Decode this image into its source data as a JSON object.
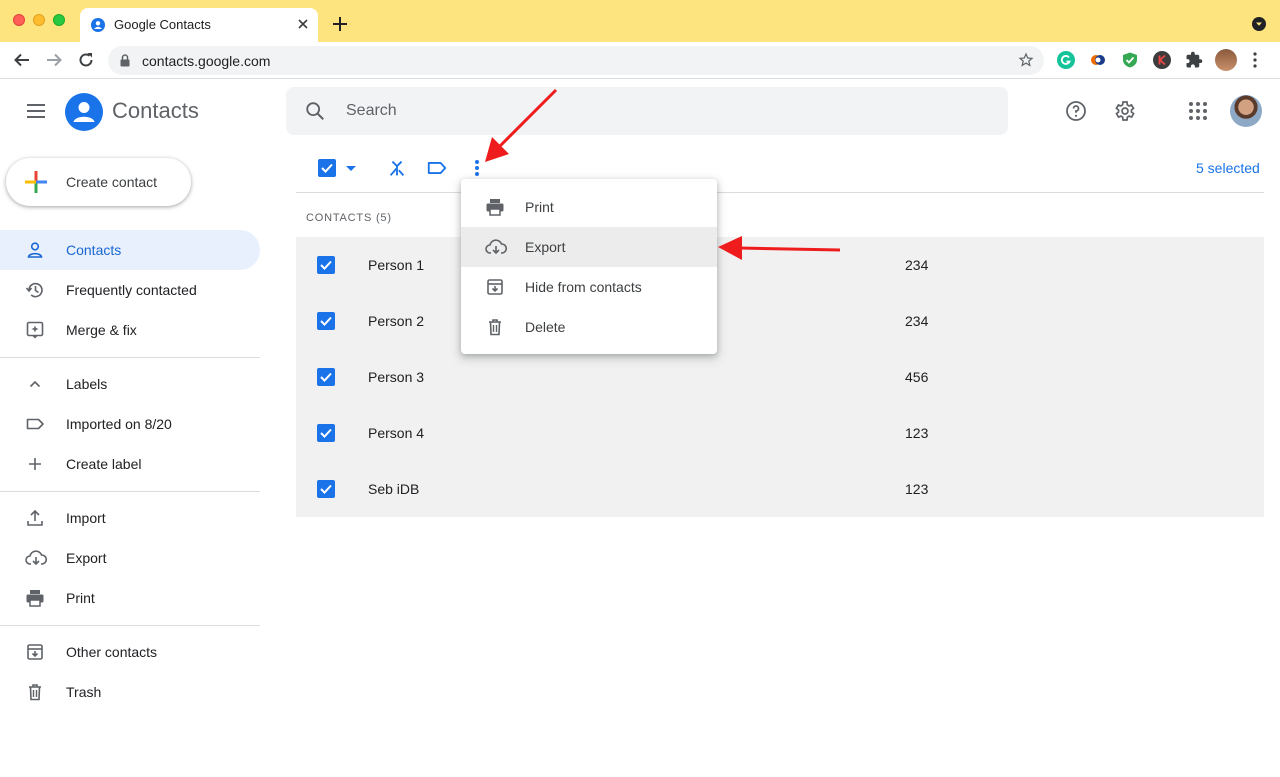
{
  "browser": {
    "tab_title": "Google Contacts",
    "url": "contacts.google.com"
  },
  "app": {
    "title": "Contacts",
    "search_placeholder": "Search"
  },
  "sidebar": {
    "create_label": "Create contact",
    "items": [
      {
        "label": "Contacts",
        "icon": "person-icon",
        "active": true
      },
      {
        "label": "Frequently contacted",
        "icon": "history-icon"
      },
      {
        "label": "Merge & fix",
        "icon": "merge-fix-icon"
      },
      {
        "label": "Labels",
        "icon": "chevron-up-icon"
      },
      {
        "label": "Imported on 8/20",
        "icon": "label-icon"
      },
      {
        "label": "Create label",
        "icon": "plus-icon"
      },
      {
        "label": "Import",
        "icon": "upload-icon"
      },
      {
        "label": "Export",
        "icon": "cloud-download-icon"
      },
      {
        "label": "Print",
        "icon": "printer-icon"
      },
      {
        "label": "Other contacts",
        "icon": "archive-icon"
      },
      {
        "label": "Trash",
        "icon": "trash-icon"
      }
    ]
  },
  "toolbar": {
    "selected_count": "5 selected"
  },
  "list": {
    "header": "CONTACTS (5)",
    "rows": [
      {
        "name": "Person 1",
        "phone": "234"
      },
      {
        "name": "Person 2",
        "phone": "234"
      },
      {
        "name": "Person 3",
        "phone": "456"
      },
      {
        "name": "Person 4",
        "phone": "123"
      },
      {
        "name": "Seb iDB",
        "phone": "123"
      }
    ]
  },
  "menu": {
    "items": [
      {
        "label": "Print",
        "icon": "printer-icon"
      },
      {
        "label": "Export",
        "icon": "cloud-download-icon",
        "highlighted": true
      },
      {
        "label": "Hide from contacts",
        "icon": "archive-icon"
      },
      {
        "label": "Delete",
        "icon": "trash-icon"
      }
    ]
  },
  "colors": {
    "accent": "#1a73e8",
    "tab_strip": "#fde47f",
    "annotation_arrow": "#ee1c1c"
  }
}
